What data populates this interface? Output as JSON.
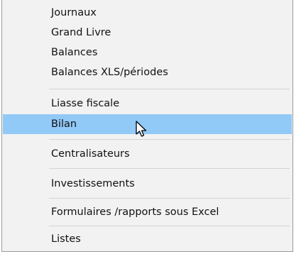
{
  "menu": {
    "items": [
      {
        "label": "Journaux"
      },
      {
        "label": "Grand Livre"
      },
      {
        "label": "Balances"
      },
      {
        "label": "Balances XLS/périodes"
      },
      {
        "label": "Liasse fiscale"
      },
      {
        "label": "Bilan",
        "highlighted": true
      },
      {
        "label": "Centralisateurs"
      },
      {
        "label": "Investissements"
      },
      {
        "label": "Formulaires /rapports sous Excel"
      },
      {
        "label": "Listes"
      }
    ]
  },
  "colors": {
    "highlight": "#91c9f7",
    "menu_background": "#f2f2f2",
    "border": "#9a9a9a",
    "separator": "#d3d3d3"
  },
  "icons": {
    "cursor": "mouse-pointer-arrow-icon"
  }
}
